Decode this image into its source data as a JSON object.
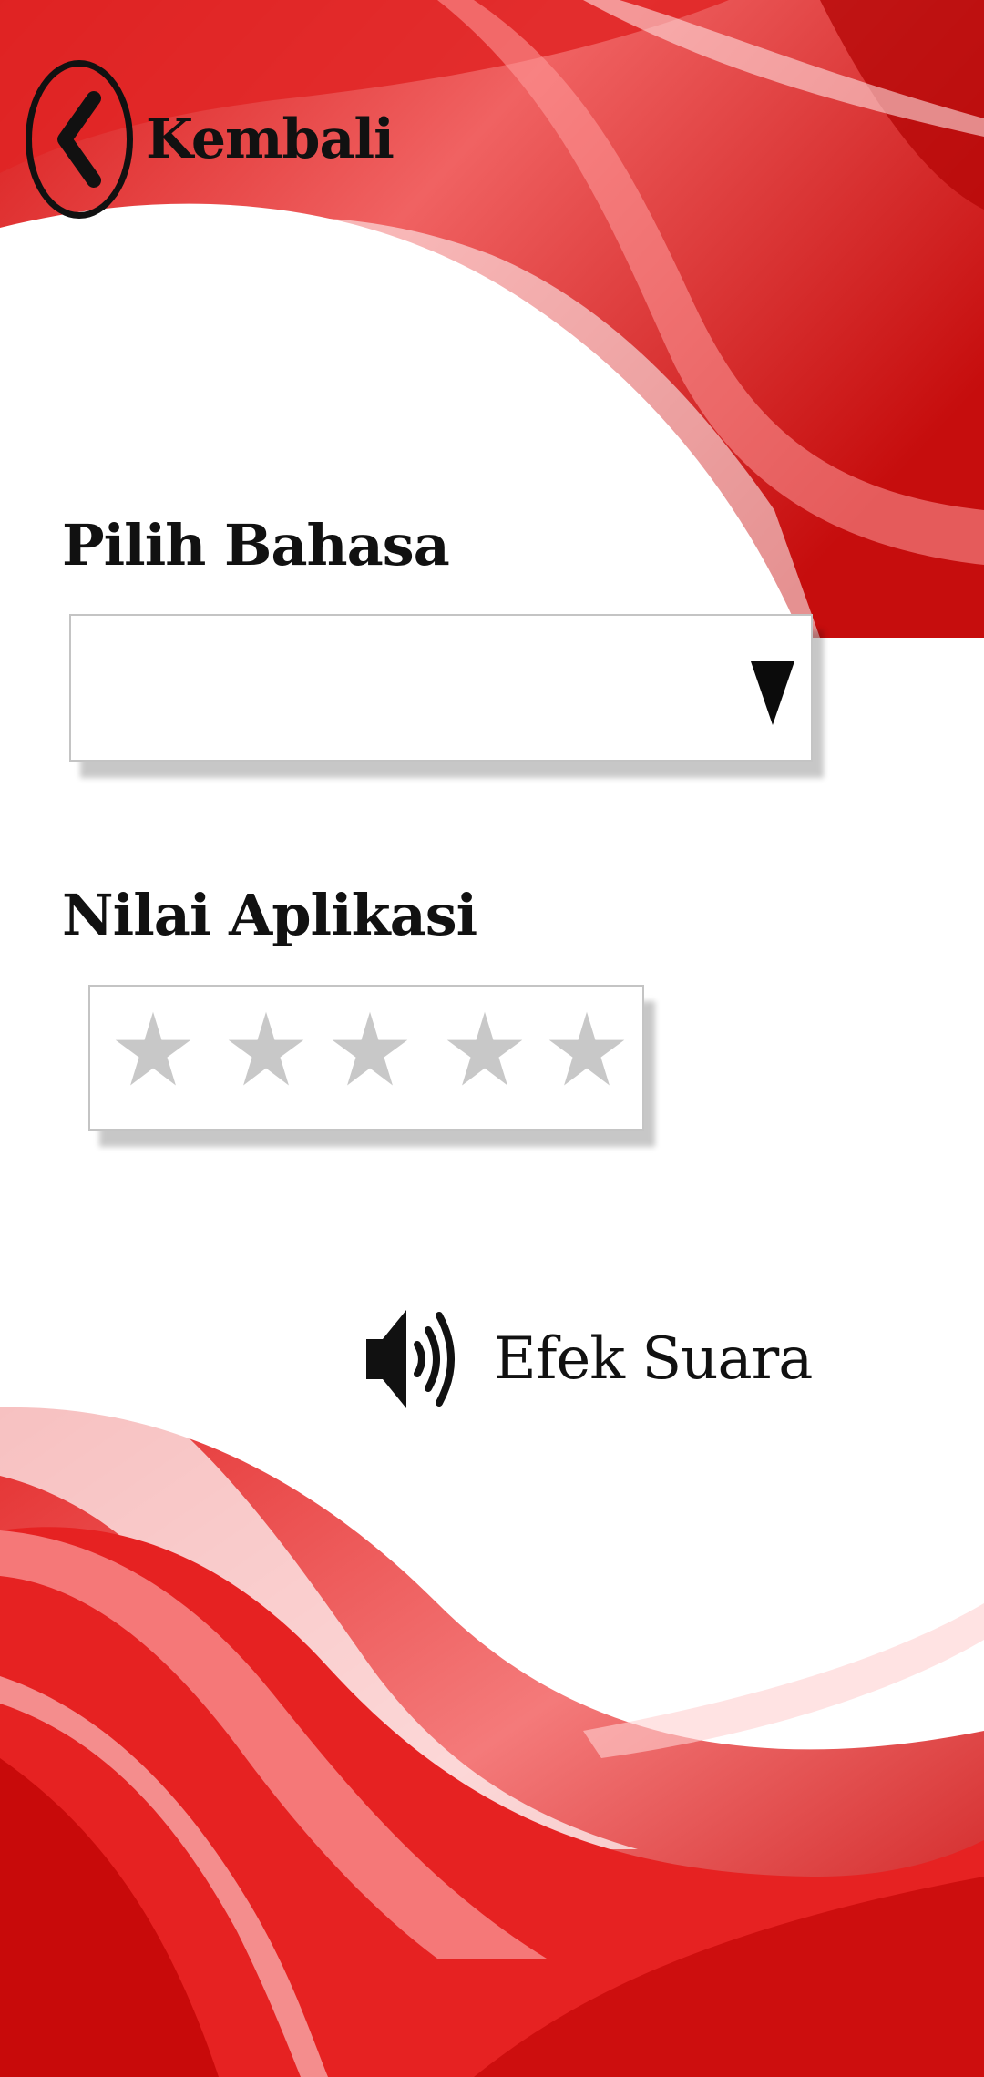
{
  "header": {
    "back_label": "Kembali"
  },
  "language": {
    "label": "Pilih Bahasa",
    "selected": ""
  },
  "rating": {
    "label": "Nilai Aplikasi",
    "stars_total": 5,
    "stars_selected": 0
  },
  "sound": {
    "label": "Efek Suara"
  },
  "colors": {
    "accent_red": "#d90f0f",
    "star_inactive": "#c8c8c8",
    "text": "#111111"
  },
  "icons": {
    "back": "chevron-left-icon",
    "dropdown": "caret-down-icon",
    "star": "star-icon",
    "sound": "speaker-icon"
  }
}
